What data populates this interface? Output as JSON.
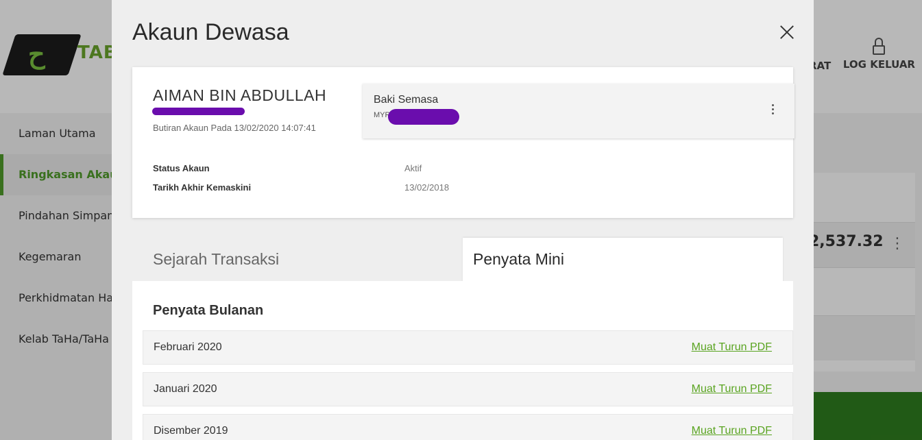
{
  "background": {
    "brand_text": "TAB",
    "nav_partial": "RAT",
    "logout_label": "LOG KELUAR",
    "menu": [
      {
        "label": "Laman Utama"
      },
      {
        "label": "Ringkasan Akaun"
      },
      {
        "label": "Pindahan Simpanan"
      },
      {
        "label": "Kegemaran"
      },
      {
        "label": "Perkhidmatan Hak"
      },
      {
        "label": "Kelab TaHa/TaHa"
      }
    ],
    "card_amount": "2,537.32",
    "colors": {
      "brand_green": "#4f9b2a",
      "link_green": "#5aa421",
      "redaction": "#6a0dad"
    }
  },
  "modal": {
    "title": "Akaun Dewasa",
    "account": {
      "holder_name": "AIMAN BIN ABDULLAH",
      "details_label": "Butiran Akaun Pada 13/02/2020 14:07:41",
      "balance_label": "Baki Semasa",
      "balance_currency": "MYR"
    },
    "info": [
      {
        "label": "Status Akaun",
        "value": "Aktif"
      },
      {
        "label": "Tarikh Akhir Kemaskini",
        "value": "13/02/2018"
      }
    ],
    "tabs": [
      {
        "label": "Sejarah Transaksi"
      },
      {
        "label": "Penyata Mini"
      }
    ],
    "statements": {
      "title": "Penyata Bulanan",
      "rows": [
        {
          "month": "Februari 2020",
          "link": "Muat Turun PDF"
        },
        {
          "month": "Januari 2020",
          "link": "Muat Turun PDF"
        },
        {
          "month": "Disember 2019",
          "link": "Muat Turun PDF"
        }
      ]
    }
  }
}
